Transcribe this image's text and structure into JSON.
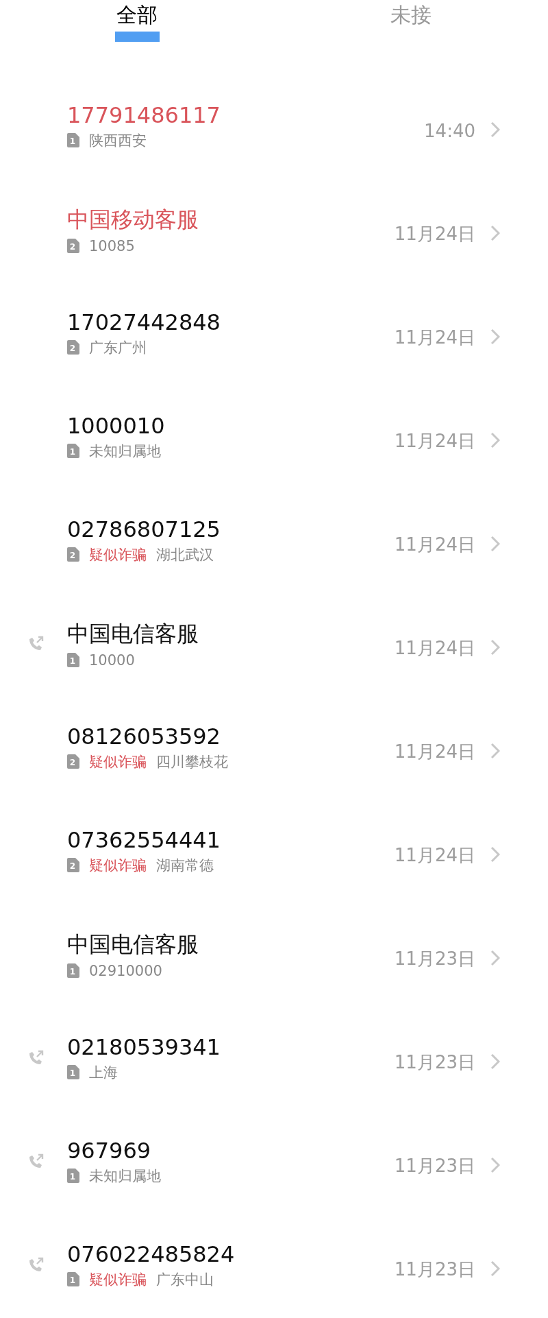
{
  "tabs": [
    {
      "label": "全部",
      "selected": true
    },
    {
      "label": "未接",
      "selected": false
    }
  ],
  "calls": [
    {
      "name": "17791486117",
      "missed": true,
      "outgoing": false,
      "sim": "1",
      "location": "陕西西安",
      "time": "14:40"
    },
    {
      "name": "中国移动客服",
      "missed": true,
      "outgoing": false,
      "sim": "2",
      "location": "10085",
      "time": "11月24日"
    },
    {
      "name": "17027442848",
      "missed": false,
      "outgoing": false,
      "sim": "2",
      "location": "广东广州",
      "time": "11月24日"
    },
    {
      "name": "1000010",
      "missed": false,
      "outgoing": false,
      "sim": "1",
      "location": "未知归属地",
      "time": "11月24日"
    },
    {
      "name": "02786807125",
      "missed": false,
      "outgoing": false,
      "sim": "2",
      "tag": "疑似诈骗",
      "location": "湖北武汉",
      "time": "11月24日"
    },
    {
      "name": "中国电信客服",
      "missed": false,
      "outgoing": true,
      "sim": "1",
      "location": "10000",
      "time": "11月24日"
    },
    {
      "name": "08126053592",
      "missed": false,
      "outgoing": false,
      "sim": "2",
      "tag": "疑似诈骗",
      "location": "四川攀枝花",
      "time": "11月24日"
    },
    {
      "name": "07362554441",
      "missed": false,
      "outgoing": false,
      "sim": "2",
      "tag": "疑似诈骗",
      "location": "湖南常德",
      "time": "11月24日"
    },
    {
      "name": "中国电信客服",
      "missed": false,
      "outgoing": false,
      "sim": "1",
      "location": "02910000",
      "time": "11月23日"
    },
    {
      "name": "02180539341",
      "missed": false,
      "outgoing": true,
      "sim": "1",
      "location": "上海",
      "time": "11月23日"
    },
    {
      "name": "967969",
      "missed": false,
      "outgoing": true,
      "sim": "1",
      "location": "未知归属地",
      "time": "11月23日"
    },
    {
      "name": "076022485824",
      "missed": false,
      "outgoing": true,
      "sim": "1",
      "tag": "疑似诈骗",
      "location": "广东中山",
      "time": "11月23日"
    }
  ]
}
